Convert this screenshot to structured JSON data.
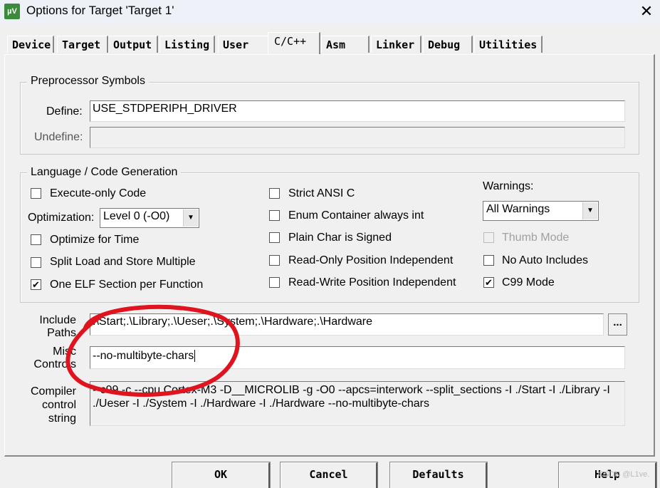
{
  "window": {
    "title": "Options for Target 'Target 1'",
    "icon": "uv-icon",
    "close": "✕"
  },
  "tabs": [
    "Device",
    "Target",
    "Output",
    "Listing",
    "User",
    "C/C++",
    "Asm",
    "Linker",
    "Debug",
    "Utilities"
  ],
  "active_tab": "C/C++",
  "preprocessor": {
    "title": "Preprocessor Symbols",
    "define_label": "Define:",
    "define_value": "USE_STDPERIPH_DRIVER",
    "undefine_label": "Undefine:",
    "undefine_value": ""
  },
  "language": {
    "title": "Language / Code Generation",
    "execute_only": {
      "label": "Execute-only Code",
      "checked": false
    },
    "optimization_label": "Optimization:",
    "optimization_value": "Level 0 (-O0)",
    "optimize_time": {
      "label": "Optimize for Time",
      "checked": false
    },
    "split_load": {
      "label": "Split Load and Store Multiple",
      "checked": false
    },
    "one_elf": {
      "label": "One ELF Section per Function",
      "checked": true
    },
    "strict_ansi": {
      "label": "Strict ANSI C",
      "checked": false
    },
    "enum_container": {
      "label": "Enum Container always int",
      "checked": false
    },
    "plain_char": {
      "label": "Plain Char is Signed",
      "checked": false
    },
    "ro_pi": {
      "label": "Read-Only Position Independent",
      "checked": false
    },
    "rw_pi": {
      "label": "Read-Write Position Independent",
      "checked": false
    },
    "warnings_label": "Warnings:",
    "warnings_value": "All Warnings",
    "thumb_mode": {
      "label": "Thumb Mode",
      "checked": false,
      "disabled": true
    },
    "no_auto_includes": {
      "label": "No Auto Includes",
      "checked": false
    },
    "c99_mode": {
      "label": "C99 Mode",
      "checked": true
    }
  },
  "include": {
    "label1": "Include",
    "label2": "Paths",
    "value": ".\\Start;.\\Library;.\\Ueser;.\\System;.\\Hardware;.\\Hardware",
    "browse": "..."
  },
  "misc": {
    "label1": "Misc",
    "label2": "Controls",
    "value": "--no-multibyte-chars"
  },
  "compiler": {
    "label1": "Compiler",
    "label2": "control",
    "label3": "string",
    "line1": "--c99 -c --cpu Cortex-M3 -D__MICROLIB -g -O0 --apcs=interwork --split_sections -I ./Start -I ./Library -I",
    "line2": "./Ueser -I ./System -I ./Hardware -I ./Hardware --no-multibyte-chars"
  },
  "buttons": {
    "ok": "OK",
    "cancel": "Cancel",
    "defaults": "Defaults",
    "help": "Help"
  },
  "watermark": "CSDN @L1ve.",
  "annotation_color": "#e0141e"
}
